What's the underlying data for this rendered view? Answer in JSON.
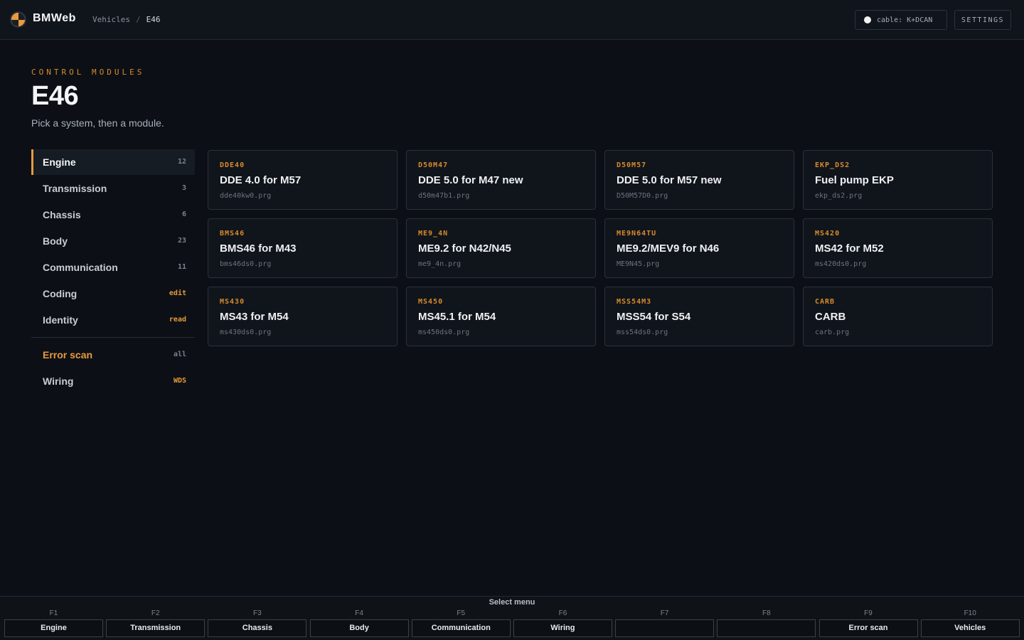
{
  "header": {
    "brand": "BMWeb",
    "breadcrumb": {
      "root": "Vehicles",
      "separator": "/",
      "current": "E46"
    },
    "cable_status": "cable: K+DCAN",
    "settings_label": "SETTINGS"
  },
  "hero": {
    "eyebrow": "CONTROL MODULES",
    "title": "E46",
    "subtitle": "Pick a system, then a module."
  },
  "sidebar": {
    "items": [
      {
        "label": "Engine",
        "badge": "12",
        "active": true
      },
      {
        "label": "Transmission",
        "badge": "3"
      },
      {
        "label": "Chassis",
        "badge": "6"
      },
      {
        "label": "Body",
        "badge": "23"
      },
      {
        "label": "Communication",
        "badge": "11"
      },
      {
        "label": "Coding",
        "badge": "edit",
        "highlight": true
      },
      {
        "label": "Identity",
        "badge": "read",
        "highlight": true
      }
    ],
    "secondary": [
      {
        "label": "Error scan",
        "badge": "all",
        "accent": true
      },
      {
        "label": "Wiring",
        "badge": "WDS",
        "highlight": true
      }
    ]
  },
  "modules": [
    {
      "code": "DDE40",
      "name": "DDE 4.0 for M57",
      "file": "dde40kw0.prg"
    },
    {
      "code": "D50M47",
      "name": "DDE 5.0 for M47 new",
      "file": "d50m47b1.prg"
    },
    {
      "code": "D50M57",
      "name": "DDE 5.0 for M57 new",
      "file": "D50M57D0.prg"
    },
    {
      "code": "EKP_DS2",
      "name": "Fuel pump EKP",
      "file": "ekp_ds2.prg"
    },
    {
      "code": "BMS46",
      "name": "BMS46 for M43",
      "file": "bms46ds0.prg"
    },
    {
      "code": "ME9_4N",
      "name": "ME9.2 for N42/N45",
      "file": "me9_4n.prg"
    },
    {
      "code": "ME9N64TU",
      "name": "ME9.2/MEV9 for N46",
      "file": "ME9N45.prg"
    },
    {
      "code": "MS420",
      "name": "MS42 for M52",
      "file": "ms420ds0.prg"
    },
    {
      "code": "MS430",
      "name": "MS43 for M54",
      "file": "ms430ds0.prg"
    },
    {
      "code": "MS450",
      "name": "MS45.1 for M54",
      "file": "ms450ds0.prg"
    },
    {
      "code": "MSS54M3",
      "name": "MSS54 for S54",
      "file": "mss54ds0.prg"
    },
    {
      "code": "CARB",
      "name": "CARB",
      "file": "carb.prg"
    }
  ],
  "function_bar": {
    "title": "Select menu",
    "keys": [
      {
        "key": "F1",
        "label": "Engine"
      },
      {
        "key": "F2",
        "label": "Transmission"
      },
      {
        "key": "F3",
        "label": "Chassis"
      },
      {
        "key": "F4",
        "label": "Body"
      },
      {
        "key": "F5",
        "label": "Communication"
      },
      {
        "key": "F6",
        "label": "Wiring"
      },
      {
        "key": "F7",
        "label": ""
      },
      {
        "key": "F8",
        "label": ""
      },
      {
        "key": "F9",
        "label": "Error scan"
      },
      {
        "key": "F10",
        "label": "Vehicles"
      }
    ]
  },
  "colors": {
    "accent": "#e89a3c",
    "background": "#0c1016",
    "panel": "#10151c"
  }
}
